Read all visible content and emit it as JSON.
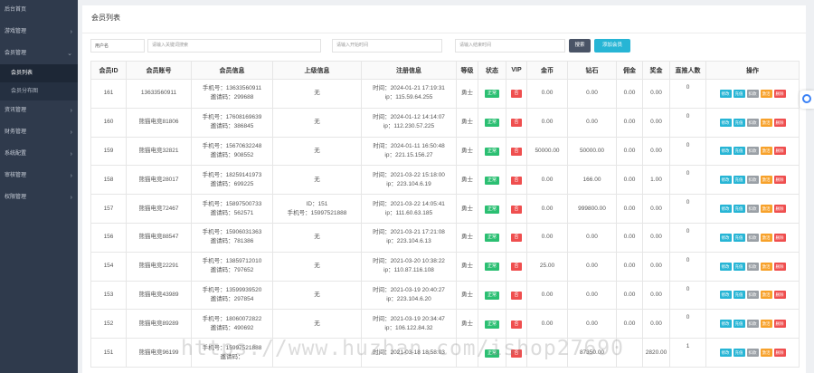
{
  "sidebar": {
    "items": [
      {
        "label": "后台首页",
        "chevron": false
      },
      {
        "label": "游戏管理",
        "chevron": true
      },
      {
        "label": "会员管理",
        "chevron": true,
        "expanded": true,
        "children": [
          {
            "label": "会员列表",
            "active": true
          },
          {
            "label": "会员分布图",
            "active": false
          }
        ]
      },
      {
        "label": "资讯管理",
        "chevron": true
      },
      {
        "label": "财务管理",
        "chevron": true
      },
      {
        "label": "系统配置",
        "chevron": true
      },
      {
        "label": "审核管理",
        "chevron": true
      },
      {
        "label": "权限管理",
        "chevron": true
      }
    ]
  },
  "page": {
    "title": "会员列表"
  },
  "filters": {
    "field_label": "用户名",
    "keyword_placeholder": "请输入关键词搜索",
    "start_placeholder": "请输入开始时间",
    "end_placeholder": "请输入结束时间",
    "search_label": "搜索",
    "add_label": "添加会员"
  },
  "table": {
    "headers": [
      "会员ID",
      "会员账号",
      "会员信息",
      "上级信息",
      "注册信息",
      "等级",
      "状态",
      "VIP",
      "金币",
      "钻石",
      "佣金",
      "奖金",
      "直推人数",
      "操作"
    ],
    "status_label": "正常",
    "vip_label": "否",
    "actions": {
      "edit": "修改",
      "recharge": "充值",
      "deduct": "扣款",
      "activate": "激活",
      "delete": "删除"
    },
    "rows": [
      {
        "id": "161",
        "account": "13633560911",
        "phone": "手机号：13633560911",
        "invite": "邀请码：299688",
        "parent": "无",
        "parent2": "",
        "time": "时间：2024-01-21 17:19:31",
        "ip": "ip：115.59.64.255",
        "level": "勇士",
        "gold": "0.00",
        "diamond": "0.00",
        "commission": "0.00",
        "bonus": "0.00",
        "direct": "0"
      },
      {
        "id": "160",
        "account": "熊猫电竞81806",
        "phone": "手机号：17608169639",
        "invite": "邀请码：386845",
        "parent": "无",
        "parent2": "",
        "time": "时间：2024-01-12 14:14:07",
        "ip": "ip：112.230.57.225",
        "level": "勇士",
        "gold": "0.00",
        "diamond": "0.00",
        "commission": "0.00",
        "bonus": "0.00",
        "direct": "0"
      },
      {
        "id": "159",
        "account": "熊猫电竞32821",
        "phone": "手机号：15670632248",
        "invite": "邀请码：908552",
        "parent": "无",
        "parent2": "",
        "time": "时间：2024-01-11 16:50:48",
        "ip": "ip：221.15.156.27",
        "level": "勇士",
        "gold": "50000.00",
        "diamond": "50000.00",
        "commission": "0.00",
        "bonus": "0.00",
        "direct": "0"
      },
      {
        "id": "158",
        "account": "熊猫电竞28017",
        "phone": "手机号：18259141973",
        "invite": "邀请码：699225",
        "parent": "无",
        "parent2": "",
        "time": "时间：2021-03-22 15:18:00",
        "ip": "ip：223.104.6.19",
        "level": "勇士",
        "gold": "0.00",
        "diamond": "166.00",
        "commission": "0.00",
        "bonus": "1.00",
        "direct": "0"
      },
      {
        "id": "157",
        "account": "熊猫电竞72467",
        "phone": "手机号：15897500733",
        "invite": "邀请码：562571",
        "parent": "ID：151",
        "parent2": "手机号：15997521888",
        "time": "时间：2021-03-22 14:05:41",
        "ip": "ip：111.60.63.185",
        "level": "勇士",
        "gold": "0.00",
        "diamond": "999800.00",
        "commission": "0.00",
        "bonus": "0.00",
        "direct": "0"
      },
      {
        "id": "156",
        "account": "熊猫电竞88547",
        "phone": "手机号：15906031363",
        "invite": "邀请码：781386",
        "parent": "无",
        "parent2": "",
        "time": "时间：2021-03-21 17:21:08",
        "ip": "ip：223.104.6.13",
        "level": "勇士",
        "gold": "0.00",
        "diamond": "0.00",
        "commission": "0.00",
        "bonus": "0.00",
        "direct": "0"
      },
      {
        "id": "154",
        "account": "熊猫电竞22291",
        "phone": "手机号：13859712010",
        "invite": "邀请码：797652",
        "parent": "无",
        "parent2": "",
        "time": "时间：2021-03-20 10:38:22",
        "ip": "ip：110.87.116.108",
        "level": "勇士",
        "gold": "25.00",
        "diamond": "0.00",
        "commission": "0.00",
        "bonus": "0.00",
        "direct": "0"
      },
      {
        "id": "153",
        "account": "熊猫电竞43989",
        "phone": "手机号：13599939520",
        "invite": "邀请码：297854",
        "parent": "无",
        "parent2": "",
        "time": "时间：2021-03-19 20:40:27",
        "ip": "ip：223.104.6.20",
        "level": "勇士",
        "gold": "0.00",
        "diamond": "0.00",
        "commission": "0.00",
        "bonus": "0.00",
        "direct": "0"
      },
      {
        "id": "152",
        "account": "熊猫电竞89289",
        "phone": "手机号：18060072822",
        "invite": "邀请码：490692",
        "parent": "无",
        "parent2": "",
        "time": "时间：2021-03-19 20:34:47",
        "ip": "ip：106.122.84.32",
        "level": "勇士",
        "gold": "0.00",
        "diamond": "0.00",
        "commission": "0.00",
        "bonus": "0.00",
        "direct": "0"
      },
      {
        "id": "151",
        "account": "熊猫电竞96199",
        "phone": "手机号：15997521888",
        "invite": "邀请码：",
        "parent": "",
        "parent2": "",
        "time": "时间：2021-03-18 18:58:03",
        "ip": "",
        "level": "",
        "gold": "",
        "diamond": "87350.00",
        "commission": "",
        "bonus": "2820.00",
        "direct": "1"
      }
    ]
  },
  "watermark": "https://www.huzhan.com/ishop27690",
  "colors": {
    "sidebar": "#2f3a4c",
    "accent": "#27b5d5",
    "danger": "#ef4f4f",
    "success": "#2bbf72",
    "warning": "#f7a12a"
  }
}
